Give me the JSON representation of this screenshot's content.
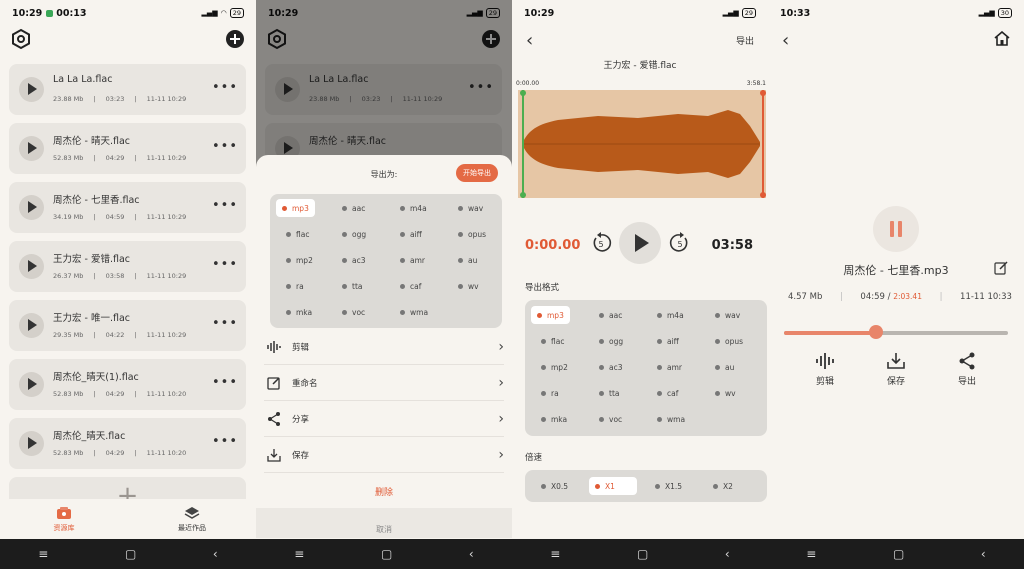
{
  "statusbar": {
    "s1": {
      "time": "10:29",
      "time2": "00:13"
    },
    "s2": {
      "time": "10:29"
    },
    "s3": {
      "time": "10:29"
    },
    "s4": {
      "time": "10:33"
    },
    "battery": "29",
    "battery4": "30"
  },
  "library": {
    "items": [
      {
        "name": "La La La.flac",
        "size": "23.88 Mb",
        "duration": "03:23",
        "date": "11-11 10:29"
      },
      {
        "name": "周杰伦 - 晴天.flac",
        "size": "52.83 Mb",
        "duration": "04:29",
        "date": "11-11 10:29"
      },
      {
        "name": "周杰伦 - 七里香.flac",
        "size": "34.19 Mb",
        "duration": "04:59",
        "date": "11-11 10:29"
      },
      {
        "name": "王力宏 - 爱错.flac",
        "size": "26.37 Mb",
        "duration": "03:58",
        "date": "11-11 10:29"
      },
      {
        "name": "王力宏 - 唯一.flac",
        "size": "29.35 Mb",
        "duration": "04:22",
        "date": "11-11 10:29"
      },
      {
        "name": "周杰伦_晴天(1).flac",
        "size": "52.83 Mb",
        "duration": "04:29",
        "date": "11-11 10:20"
      },
      {
        "name": "周杰伦_晴天.flac",
        "size": "52.83 Mb",
        "duration": "04:29",
        "date": "11-11 10:20"
      }
    ],
    "more": "•••",
    "add": "+",
    "tabs": [
      {
        "label": "资源库"
      },
      {
        "label": "最近作品"
      }
    ]
  },
  "export_sheet": {
    "title": "导出为:",
    "start_button": "开始导出",
    "formats": [
      "mp3",
      "aac",
      "m4a",
      "wav",
      "flac",
      "ogg",
      "aiff",
      "opus",
      "mp2",
      "ac3",
      "amr",
      "au",
      "ra",
      "tta",
      "caf",
      "wv",
      "mka",
      "voc",
      "wma"
    ],
    "selected_format": "mp3",
    "menu": [
      {
        "label": "剪辑"
      },
      {
        "label": "重命名"
      },
      {
        "label": "分享"
      },
      {
        "label": "保存"
      }
    ],
    "delete": "删除",
    "cancel": "取消"
  },
  "editor": {
    "title": "王力宏 - 爱错.flac",
    "export_link": "导出",
    "range_start": "0:00.00",
    "range_end": "3:58.1",
    "current_time": "0:00.00",
    "total_time": "03:58",
    "skip_seconds": "5",
    "format_section": "导出格式",
    "speed_section": "倍速",
    "speeds": [
      "X0.5",
      "X1",
      "X1.5",
      "X2"
    ],
    "selected_speed": "X1"
  },
  "player": {
    "title": "周杰伦 - 七里香.mp3",
    "size": "4.57 Mb",
    "duration": "04:59",
    "position": "2:03.41",
    "date": "11-11 10:33",
    "progress": 0.41,
    "actions": [
      {
        "label": "剪辑"
      },
      {
        "label": "保存"
      },
      {
        "label": "导出"
      }
    ]
  },
  "colors": {
    "accent": "#e05a35",
    "wave": "#b85a1a",
    "wave_bg": "#e6c6a5",
    "background": "#f7f4ef"
  }
}
